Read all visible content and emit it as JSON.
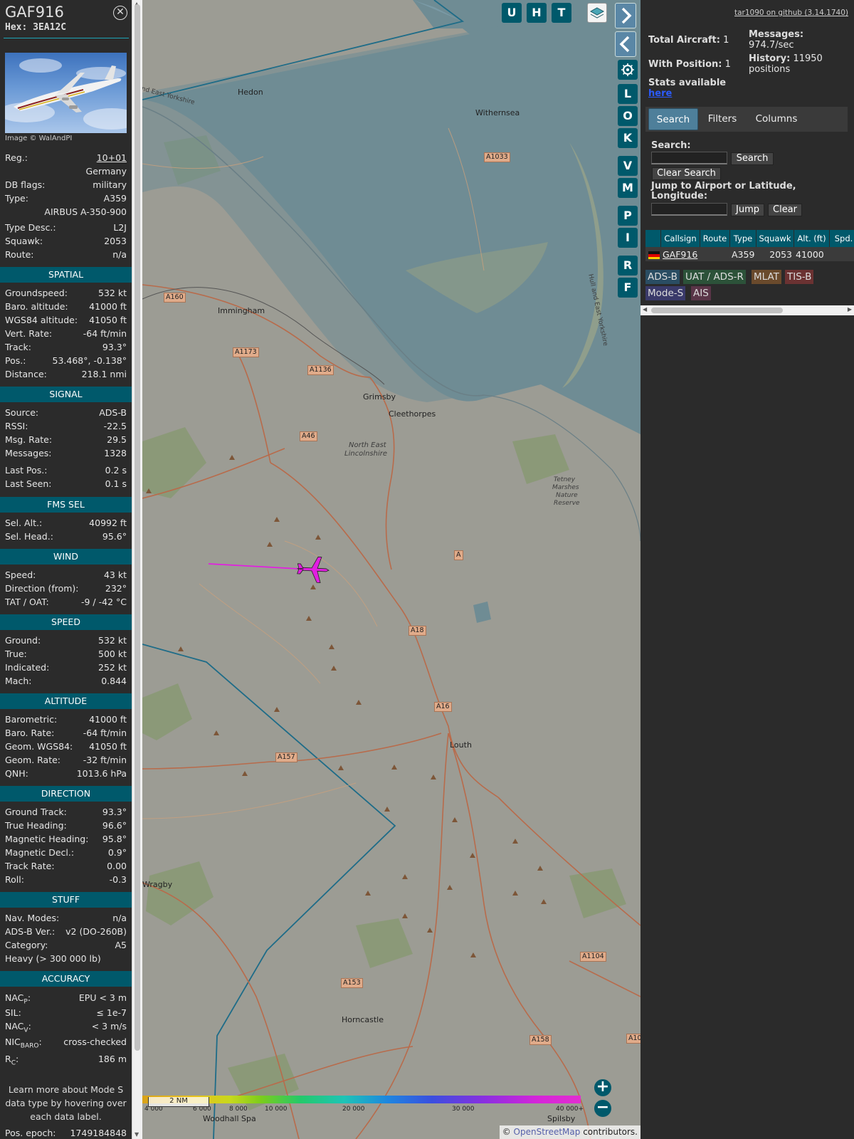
{
  "header": {
    "callsign": "GAF916",
    "hex": "Hex: 3EA12C",
    "image_credit": "Image © WalAndPI"
  },
  "details": {
    "reg_label": "Reg.:",
    "reg_value": "10+01",
    "country": "Germany",
    "db_flags_label": "DB flags:",
    "db_flags_value": "military",
    "type_label": "Type:",
    "type_value": "A359",
    "type_full": "AIRBUS A-350-900",
    "type_desc_label": "Type Desc.:",
    "type_desc_value": "L2J",
    "squawk_label": "Squawk:",
    "squawk_value": "2053",
    "route_label": "Route:",
    "route_value": "n/a"
  },
  "spatial": {
    "title": "SPATIAL",
    "rows": [
      {
        "label": "Groundspeed:",
        "value": "532 kt"
      },
      {
        "label": "Baro. altitude:",
        "value": "41000 ft"
      },
      {
        "label": "WGS84 altitude:",
        "value": "41050 ft"
      },
      {
        "label": "Vert. Rate:",
        "value": "-64 ft/min"
      },
      {
        "label": "Track:",
        "value": "93.3°"
      },
      {
        "label": "Pos.:",
        "value": "53.468°, -0.138°"
      },
      {
        "label": "Distance:",
        "value": "218.1 nmi"
      }
    ]
  },
  "signal": {
    "title": "SIGNAL",
    "rows": [
      {
        "label": "Source:",
        "value": "ADS-B"
      },
      {
        "label": "RSSI:",
        "value": "-22.5"
      },
      {
        "label": "Msg. Rate:",
        "value": "29.5"
      },
      {
        "label": "Messages:",
        "value": "1328"
      },
      {
        "label": "Last Pos.:",
        "value": "0.2 s"
      },
      {
        "label": "Last Seen:",
        "value": "0.1 s"
      }
    ]
  },
  "fms": {
    "title": "FMS SEL",
    "rows": [
      {
        "label": "Sel. Alt.:",
        "value": "40992 ft"
      },
      {
        "label": "Sel. Head.:",
        "value": "95.6°"
      }
    ]
  },
  "wind": {
    "title": "WIND",
    "rows": [
      {
        "label": "Speed:",
        "value": "43 kt"
      },
      {
        "label": "Direction (from):",
        "value": "232°"
      },
      {
        "label": "TAT / OAT:",
        "value": "-9 / -42 °C"
      }
    ]
  },
  "speed": {
    "title": "SPEED",
    "rows": [
      {
        "label": "Ground:",
        "value": "532 kt"
      },
      {
        "label": "True:",
        "value": "500 kt"
      },
      {
        "label": "Indicated:",
        "value": "252 kt"
      },
      {
        "label": "Mach:",
        "value": "0.844"
      }
    ]
  },
  "altitude": {
    "title": "ALTITUDE",
    "rows": [
      {
        "label": "Barometric:",
        "value": "41000 ft"
      },
      {
        "label": "Baro. Rate:",
        "value": "-64 ft/min"
      },
      {
        "label": "Geom. WGS84:",
        "value": "41050 ft"
      },
      {
        "label": "Geom. Rate:",
        "value": "-32 ft/min"
      },
      {
        "label": "QNH:",
        "value": "1013.6 hPa"
      }
    ]
  },
  "direction": {
    "title": "DIRECTION",
    "rows": [
      {
        "label": "Ground Track:",
        "value": "93.3°"
      },
      {
        "label": "True Heading:",
        "value": "96.6°"
      },
      {
        "label": "Magnetic Heading:",
        "value": "95.8°"
      },
      {
        "label": "Magnetic Decl.:",
        "value": "0.9°"
      },
      {
        "label": "Track Rate:",
        "value": "0.00"
      },
      {
        "label": "Roll:",
        "value": "-0.3"
      }
    ]
  },
  "stuff": {
    "title": "STUFF",
    "rows": [
      {
        "label": "Nav. Modes:",
        "value": "n/a"
      },
      {
        "label": "ADS-B Ver.:",
        "value": "v2 (DO-260B)"
      },
      {
        "label": "Category:",
        "value": "A5"
      }
    ],
    "category_desc": "Heavy (> 300 000 lb)"
  },
  "accuracy": {
    "title": "ACCURACY",
    "nacp_label": "NAC",
    "nacp_sub": "P",
    "nacp_value": "EPU < 3 m",
    "sil_label": "SIL:",
    "sil_value": "≤ 1e-7",
    "nacv_label": "NAC",
    "nacv_sub": "V",
    "nacv_value": "< 3 m/s",
    "nicbaro_label": "NIC",
    "nicbaro_sub": "BARO",
    "nicbaro_value": "cross-checked",
    "rc_label": "R",
    "rc_sub": "C",
    "rc_value": "186 m",
    "colon": ":"
  },
  "footer": {
    "note": "Learn more about Mode S data type by hovering over each data label.",
    "pos_epoch_label": "Pos. epoch:",
    "pos_epoch_value": "1749184848"
  },
  "map": {
    "buttons_top": [
      "U",
      "H",
      "T"
    ],
    "buttons_side": [
      "L",
      "O",
      "K",
      "V",
      "M",
      "P",
      "I",
      "R",
      "F"
    ],
    "places": [
      "Hedon",
      "Withernsea",
      "Immingham",
      "Grimsby",
      "Cleethorpes",
      "North East",
      "Lincolnshire",
      "Tetney",
      "Marshes",
      "Nature",
      "Reserve",
      "Louth",
      "Horncastle",
      "Spilsby",
      "Woodhall Spa",
      "Wragby",
      "Hull and East Yorkshire",
      "nd East Yorkshire"
    ],
    "roads": [
      "A1033",
      "A160",
      "A1173",
      "A1136",
      "A46",
      "A18",
      "A16",
      "A157",
      "A153",
      "A158",
      "A1104",
      "A10",
      "A"
    ],
    "scale": "2 NM",
    "attribution_symbol": "©",
    "attribution_link": "OpenStreetMap",
    "attribution_rest": "contributors.",
    "altitude_legend": [
      "4 000",
      "6 000",
      "8 000",
      "10 000",
      "20 000",
      "30 000",
      "40 000+"
    ],
    "zoom_in": "+",
    "zoom_out": "−"
  },
  "panel": {
    "version": "tar1090 on github (3.14.1740)",
    "total_aircraft_label": "Total Aircraft:",
    "total_aircraft_value": "1",
    "with_position_label": "With Position:",
    "with_position_value": "1",
    "messages_label": "Messages:",
    "messages_value": "974.7/sec",
    "history_label": "History:",
    "history_value": "11950",
    "history_unit": "positions",
    "stats_label": "Stats available",
    "stats_link": "here",
    "tabs": [
      "Search",
      "Filters",
      "Columns"
    ],
    "search_label": "Search:",
    "search_button": "Search",
    "clear_search_button": "Clear Search",
    "jump_label": "Jump to Airport or Latitude, Longitude:",
    "jump_button": "Jump",
    "clear_button": "Clear",
    "table_headers": [
      "Callsign",
      "Route",
      "Type",
      "Squawk",
      "Alt. (ft)",
      "Spd."
    ],
    "table_rows": [
      {
        "callsign": "GAF916",
        "route": "",
        "type": "A359",
        "squawk": "2053",
        "alt": "41000",
        "spd": ""
      }
    ],
    "badges": [
      {
        "label": "ADS-B",
        "color": "#2a4d63"
      },
      {
        "label": "UAT / ADS-R",
        "color": "#2c5239"
      },
      {
        "label": "MLAT",
        "color": "#6a4a2c"
      },
      {
        "label": "TIS-B",
        "color": "#6b3232"
      },
      {
        "label": "Mode-S",
        "color": "#3a3a6a"
      },
      {
        "label": "AIS",
        "color": "#5a3548"
      }
    ]
  },
  "colors": {
    "accent": "#00596b",
    "track": "#e21fe0",
    "aircraft": "#e21fe0",
    "water": "#6f8c94",
    "land": "#9c9c94"
  }
}
